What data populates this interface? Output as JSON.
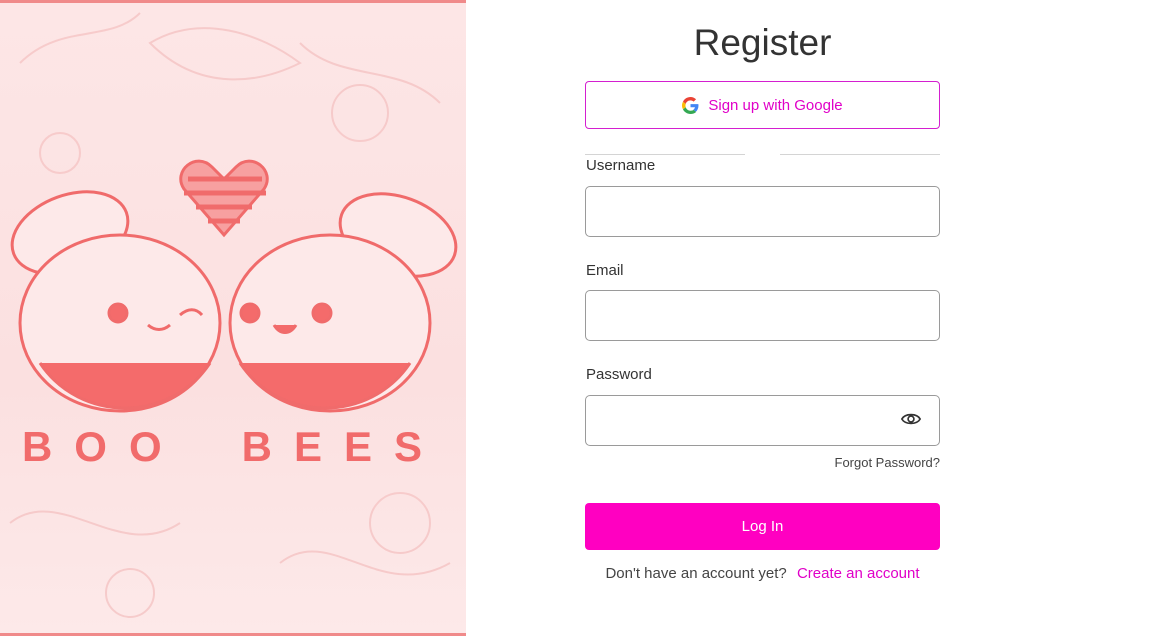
{
  "art": {
    "brand_words": [
      "BOO",
      "BEES"
    ],
    "colors": {
      "accent": "#f16b6b",
      "background": "#fde6e6"
    }
  },
  "form": {
    "title": "Register",
    "google_button_label": "Sign up with Google",
    "username_label": "Username",
    "username_value": "",
    "email_label": "Email",
    "email_value": "",
    "password_label": "Password",
    "password_value": "",
    "forgot_password": "Forgot Password?",
    "login_button_label": "Log In",
    "no_account_text": "Don't have an account yet?",
    "create_account_link": "Create an account"
  },
  "icons": {
    "google": "google-g-icon",
    "password_toggle": "eye-icon"
  },
  "colors": {
    "primary": "#ff00c1",
    "link": "#e000c8",
    "google_border": "#d41fd0",
    "input_border": "#9a9a9a"
  }
}
